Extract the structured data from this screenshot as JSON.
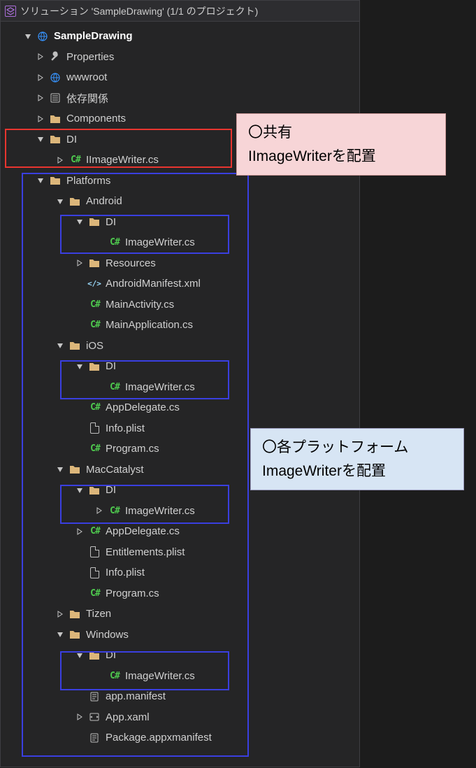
{
  "header": {
    "title": "ソリューション 'SampleDrawing' (1/1 のプロジェクト)"
  },
  "project": {
    "name": "SampleDrawing"
  },
  "items": {
    "properties": "Properties",
    "wwwroot": "wwwroot",
    "deps": "依存関係",
    "components": "Components",
    "di": "DI",
    "iimagewriter": "IImageWriter.cs",
    "platforms": "Platforms",
    "android": "Android",
    "imagewriter": "ImageWriter.cs",
    "resources": "Resources",
    "androidmanifest": "AndroidManifest.xml",
    "mainactivity": "MainActivity.cs",
    "mainapplication": "MainApplication.cs",
    "ios": "iOS",
    "appdelegate": "AppDelegate.cs",
    "infoplist": "Info.plist",
    "program": "Program.cs",
    "maccatalyst": "MacCatalyst",
    "entitlements": "Entitlements.plist",
    "tizen": "Tizen",
    "windows": "Windows",
    "appmanifest": "app.manifest",
    "appxaml": "App.xaml",
    "packageappx": "Package.appxmanifest"
  },
  "annotations": {
    "shared": {
      "line1": "〇共有",
      "line2": "IImageWriterを配置"
    },
    "platform": {
      "line1": "〇各プラットフォーム",
      "line2": "ImageWriterを配置"
    }
  }
}
